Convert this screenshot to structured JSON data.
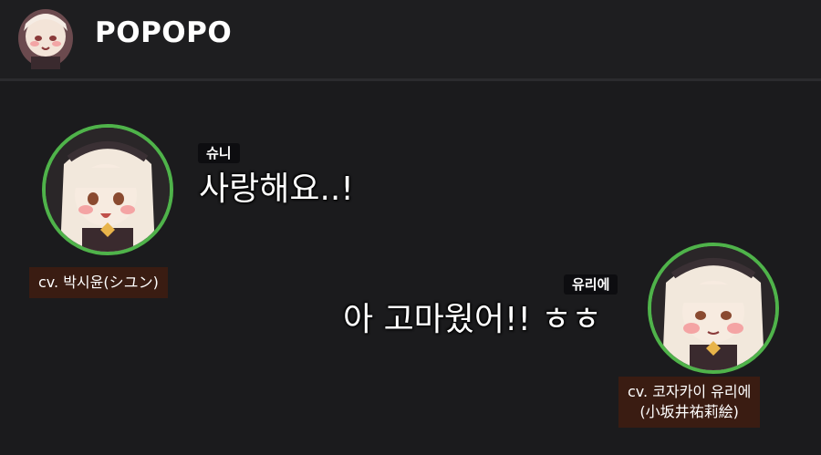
{
  "app": {
    "title": "POPOPO"
  },
  "colors": {
    "background": "#1c1c1e",
    "avatar_ring": "#4fb34a",
    "name_tag_bg": "#0d0d10",
    "cv_label_bg": "#3a1c12"
  },
  "messages": [
    {
      "speaker": "슈니",
      "text": "사랑해요..!",
      "side": "left"
    },
    {
      "speaker": "유리에",
      "text": "아 고마웠어!! ㅎㅎ",
      "side": "right"
    }
  ],
  "cast": [
    {
      "line1": "cv. 박시윤(シユン)"
    },
    {
      "line1": "cv. 코자카이 유리에",
      "line2": "(小坂井祐莉絵)"
    }
  ],
  "icons": {
    "app_avatar": "chibi-character-avatar-icon",
    "left_avatar": "shuni-character-avatar-icon",
    "right_avatar": "yurie-character-avatar-icon"
  }
}
